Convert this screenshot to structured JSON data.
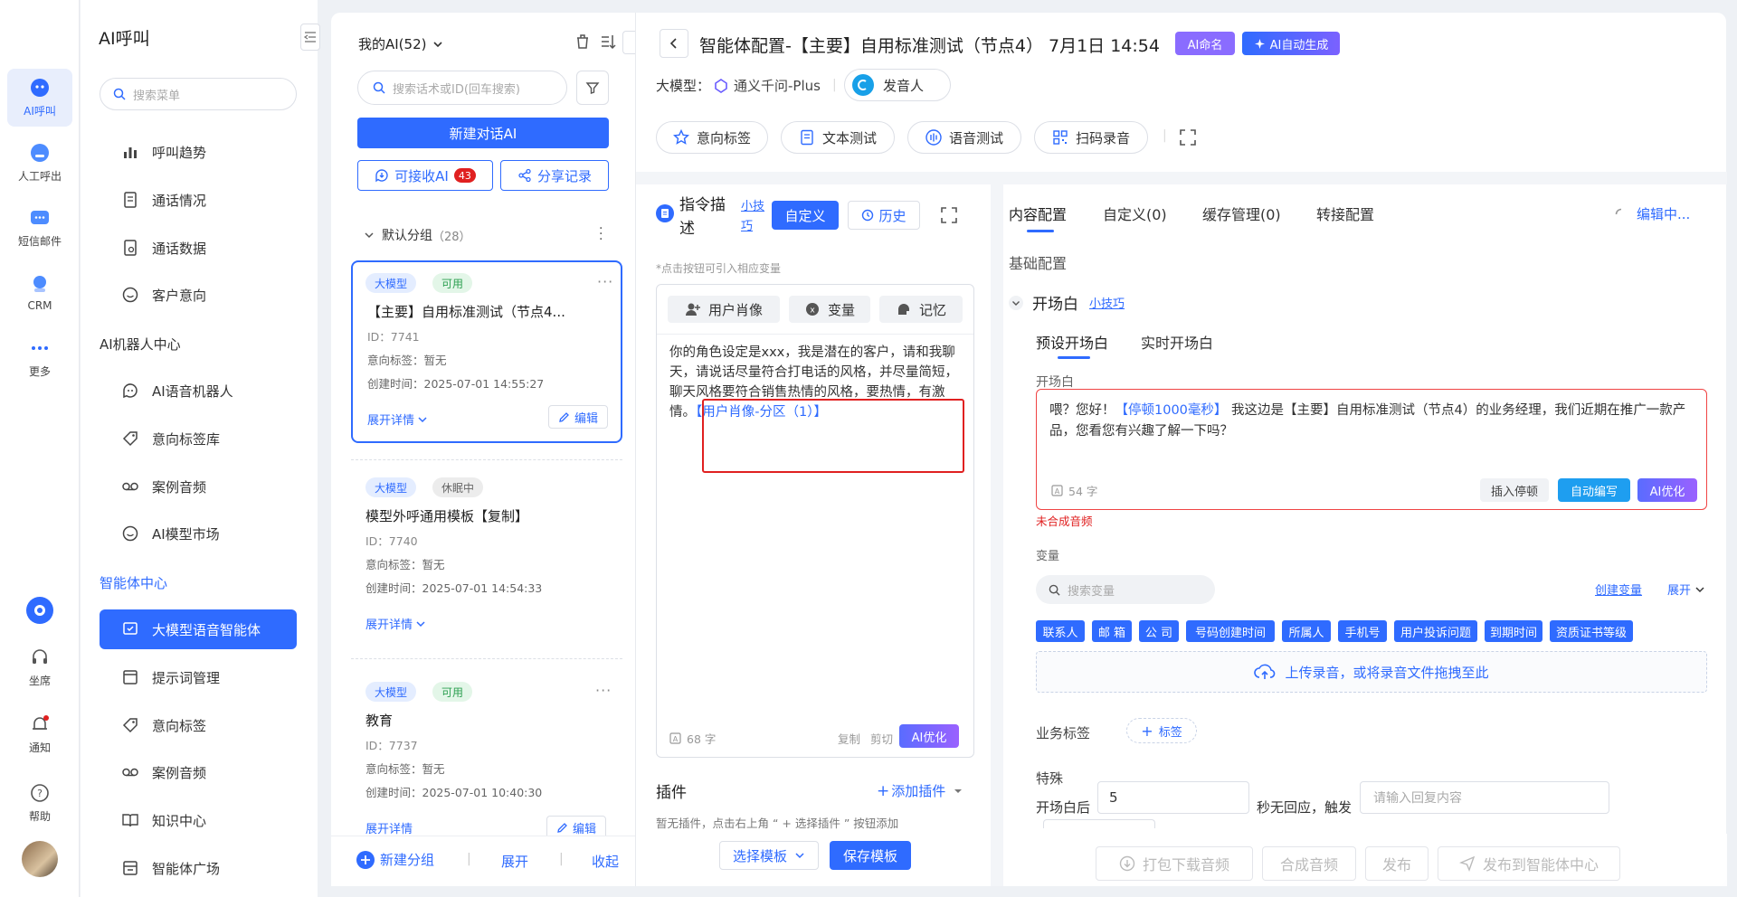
{
  "rail": {
    "items": [
      {
        "label": "AI呼叫"
      },
      {
        "label": "人工呼出"
      },
      {
        "label": "短信邮件"
      },
      {
        "label": "CRM"
      },
      {
        "label": "更多"
      },
      {
        "label": "坐席"
      },
      {
        "label": "通知"
      },
      {
        "label": "帮助"
      }
    ]
  },
  "menu": {
    "title": "AI呼叫",
    "search_placeholder": "搜索菜单",
    "group1": [
      "呼叫趋势",
      "通话情况",
      "通话数据",
      "客户意向"
    ],
    "section2": "AI机器人中心",
    "group2": [
      "AI语音机器人",
      "意向标签库",
      "案例音频",
      "AI模型市场"
    ],
    "section3": "智能体中心",
    "group3": [
      "大模型语音智能体",
      "提示词管理",
      "意向标签",
      "案例音频",
      "知识中心",
      "智能体广场"
    ]
  },
  "list": {
    "header": "我的AI(52)",
    "search_placeholder": "搜索话术或ID(回车搜索)",
    "new_button": "新建对话AI",
    "receive_button": "可接收AI",
    "receive_badge": "43",
    "share_button": "分享记录",
    "group_name": "默认分组",
    "group_count": "（28）",
    "cards": [
      {
        "tag1": "大模型",
        "tag2": "可用",
        "name": "【主要】自用标准测试（节点4...",
        "id": "ID：7741",
        "intent": "意向标签：暂无",
        "created": "创建时间：2025-07-01 14:55:27",
        "expand": "展开详情",
        "edit": "编辑"
      },
      {
        "tag1": "大模型",
        "tag2": "休眠中",
        "name": "模型外呼通用模板【复制】",
        "id": "ID：7740",
        "intent": "意向标签：暂无",
        "created": "创建时间：2025-07-01 14:54:33",
        "expand": "展开详情"
      },
      {
        "tag1": "大模型",
        "tag2": "可用",
        "name": "教育",
        "id": "ID：7737",
        "intent": "意向标签：暂无",
        "created": "创建时间：2025-07-01 10:40:30",
        "expand": "展开详情",
        "edit": "编辑"
      }
    ],
    "footer": {
      "new_group": "新建分组",
      "expand": "展开",
      "collapse": "收起"
    }
  },
  "config": {
    "title": "智能体配置-【主要】自用标准测试（节点4） 7月1日 14:54",
    "ai_name_btn": "AI命名",
    "ai_gen_btn": "AI自动生成",
    "model_label": "大模型：",
    "model_name": "通义千问-Plus",
    "speaker": "发音人",
    "toolbar": [
      "意向标签",
      "文本测试",
      "语音测试",
      "扫码录音"
    ],
    "instr": {
      "title": "指令描述",
      "tips": "小技巧",
      "custom_btn": "自定义",
      "history_btn": "历史",
      "hint": "*点击按钮可引入相应变量",
      "var_buttons": [
        "用户肖像",
        "变量",
        "记忆"
      ],
      "body_text": "你的角色设定是xxx，我是潜在的客户，请和我聊天，请说话尽量符合打电话的风格，并尽量简短，聊天风格要符合销售热情的风格，要热情，有激情。",
      "body_link": "【用户肖像-分区（1）】",
      "count": "68 字",
      "copy": "复制",
      "cut": "剪切",
      "ai_opt": "AI优化"
    },
    "plugin": {
      "title": "插件",
      "add": "添加插件",
      "hint": "暂无插件，点击右上角 “ + 选择插件 ” 按钮添加",
      "choose_template": "选择模板",
      "save_template": "保存模板"
    },
    "tabs": [
      "内容配置",
      "自定义(0)",
      "缓存管理(0)",
      "转接配置"
    ],
    "editing": "编辑中...",
    "basic": "基础配置",
    "opening": {
      "title": "开场白",
      "tips": "小技巧",
      "subtabs": [
        "预设开场白",
        "实时开场白"
      ],
      "label": "开场白",
      "text_a": "喂？您好！",
      "pause": "【停顿1000毫秒】",
      "text_b": "我这边是【主要】自用标准测试（节点4）的业务经理，我们近期在推广一款产品，您看您有兴趣了解一下吗？",
      "count": "54 字",
      "insert_pause": "插入停顿",
      "auto_write": "自动编写",
      "ai_opt": "AI优化",
      "warning": "未合成音频"
    },
    "variables": {
      "label": "变量",
      "search_placeholder": "搜索变量",
      "create": "创建变量",
      "expand": "展开",
      "tags": [
        "联系人",
        "邮 箱",
        "公 司",
        "号码创建时间",
        "所属人",
        "手机号",
        "用户投诉问题",
        "到期时间",
        "资质证书等级"
      ],
      "upload": "上传录音，或将录音文件拖拽至此"
    },
    "biz_tag": {
      "label": "业务标签",
      "add": "标签"
    },
    "special": {
      "label": "特殊",
      "after": "开场白后",
      "seconds": "5",
      "no_reply": "秒无回应，触发",
      "reply_placeholder": "请输入回复内容"
    },
    "bottom": [
      "打包下载音频",
      "合成音频",
      "发布",
      "发布到智能体中心"
    ]
  },
  "colors": {
    "accent": "#2f6bff",
    "danger": "#e02020",
    "purple": "#7b61ff"
  }
}
